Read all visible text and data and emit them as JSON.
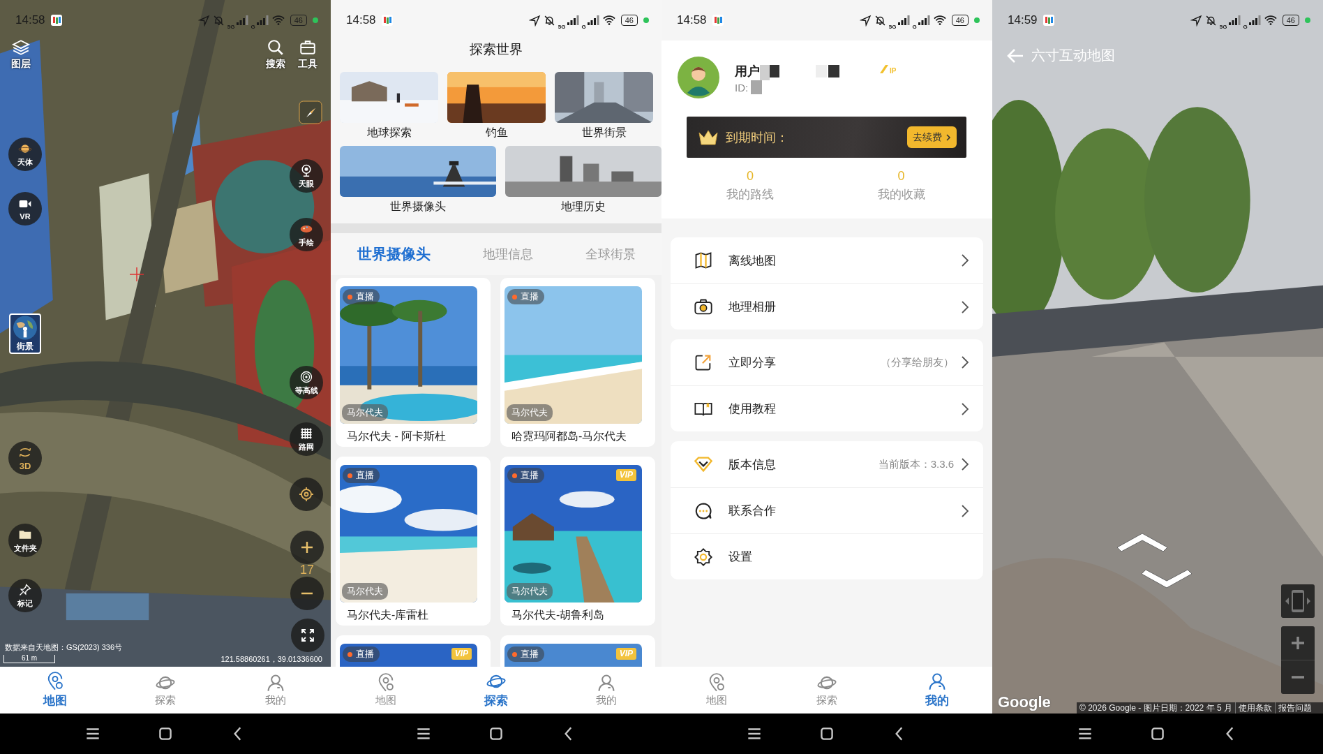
{
  "map_screen": {
    "status_bar": {
      "time": "14:58",
      "signals": [
        "5G",
        "G"
      ],
      "battery": "46"
    },
    "controls": [
      {
        "kind": "layers",
        "label": "图层"
      },
      {
        "kind": "search",
        "label": "搜索"
      },
      {
        "kind": "toolbox",
        "label": "工具"
      },
      {
        "kind": "compass"
      },
      {
        "kind": "planet",
        "label": "天体"
      },
      {
        "kind": "vr",
        "label": "VR"
      },
      {
        "kind": "camera",
        "label": "天眼"
      },
      {
        "kind": "palette",
        "label": "手绘"
      },
      {
        "kind": "streetview",
        "label": "街景"
      },
      {
        "kind": "contour",
        "label": "等高线"
      },
      {
        "kind": "grid",
        "label": "路网"
      },
      {
        "kind": "rotate",
        "label": "3D"
      },
      {
        "kind": "locate"
      },
      {
        "kind": "folder",
        "label": "文件夹"
      },
      {
        "kind": "zoom_in"
      },
      {
        "kind": "zoom_out"
      },
      {
        "kind": "pin",
        "label": "标记"
      },
      {
        "kind": "fullscreen"
      }
    ],
    "zoom_level": "17",
    "attribution": "数据来自天地图：GS(2023) 336号",
    "scale": "61 m",
    "coordinates": "121.58860261，39.01336600",
    "nav": [
      {
        "label": "地图",
        "selected": true
      },
      {
        "label": "探索",
        "selected": false
      },
      {
        "label": "我的",
        "selected": false
      }
    ]
  },
  "explore_screen": {
    "status_bar": {
      "time": "14:58",
      "signals": [
        "5G",
        "G"
      ],
      "battery": "46"
    },
    "title": "探索世界",
    "topics": [
      "地球探索",
      "钓鱼",
      "世界街景",
      "世界摄像头",
      "地理历史"
    ],
    "tabs": [
      {
        "label": "世界摄像头",
        "selected": true
      },
      {
        "label": "地理信息",
        "selected": false
      },
      {
        "label": "全球街景",
        "selected": false
      }
    ],
    "cards": [
      {
        "live": "直播",
        "location": "马尔代夫",
        "title": "马尔代夫 - 阿卡斯杜"
      },
      {
        "live": "直播",
        "location": "马尔代夫",
        "title": "哈霓玛阿都岛-马尔代夫"
      },
      {
        "live": "直播",
        "location": "马尔代夫",
        "title": "马尔代夫-库雷杜"
      },
      {
        "live": "直播",
        "vip": "VIP",
        "location": "马尔代夫",
        "title": "马尔代夫-胡鲁利岛"
      },
      {
        "live": "直播",
        "vip": "VIP"
      },
      {
        "live": "直播",
        "vip": "VIP"
      }
    ],
    "nav": [
      {
        "label": "地图",
        "selected": false
      },
      {
        "label": "探索",
        "selected": true
      },
      {
        "label": "我的",
        "selected": false
      }
    ]
  },
  "profile_screen": {
    "status_bar": {
      "time": "14:58",
      "signals": [
        "5G",
        "G"
      ],
      "battery": "46"
    },
    "user": {
      "name": "用户",
      "id_label": "ID:",
      "vip_mark": "IP"
    },
    "membership": {
      "label": "到期时间：",
      "button": "去续费"
    },
    "stats": [
      {
        "value": "0",
        "label": "我的路线"
      },
      {
        "value": "0",
        "label": "我的收藏"
      }
    ],
    "groups": [
      {
        "items": [
          {
            "kind": "map",
            "label": "离线地图",
            "chevron": true
          },
          {
            "kind": "camera",
            "label": "地理相册",
            "chevron": true
          }
        ]
      },
      {
        "items": [
          {
            "kind": "share",
            "label": "立即分享",
            "detail": "（分享给朋友）",
            "chevron": true
          },
          {
            "kind": "book",
            "label": "使用教程",
            "chevron": true
          }
        ]
      },
      {
        "items": [
          {
            "kind": "diamond",
            "label": "版本信息",
            "detail": "当前版本：3.3.6",
            "chevron": true
          },
          {
            "kind": "chat",
            "label": "联系合作",
            "chevron": true
          },
          {
            "kind": "gear",
            "label": "设置",
            "chevron": false
          }
        ]
      }
    ],
    "nav": [
      {
        "label": "地图",
        "selected": false
      },
      {
        "label": "探索",
        "selected": false
      },
      {
        "label": "我的",
        "selected": true
      }
    ]
  },
  "street_screen": {
    "status_bar": {
      "time": "14:59",
      "signals": [
        "5G",
        "G"
      ],
      "battery": "46"
    },
    "title": "六寸互动地图",
    "logo": "Google",
    "attribution": "© 2026 Google - 图片日期：2022 年 5 月",
    "links": [
      "使用条款",
      "报告问题"
    ]
  }
}
